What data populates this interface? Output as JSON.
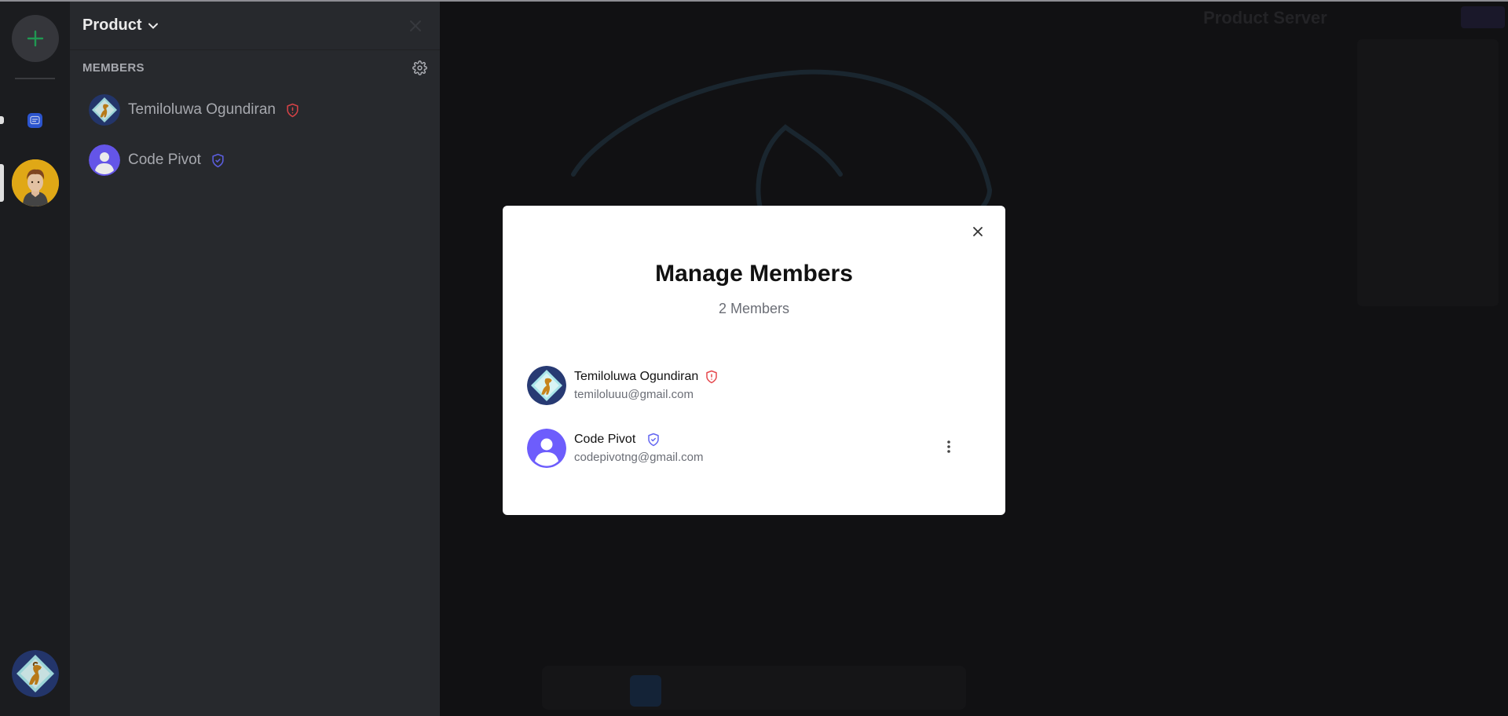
{
  "rail": {
    "add_icon": "plus-icon",
    "accent": "#23a55a",
    "server_icon": "message-square-icon",
    "avatar_icon": "user-avatar-icon"
  },
  "sidebar": {
    "server_name": "Product",
    "members_label": "MEMBERS",
    "members": [
      {
        "name": "Temiloluwa Ogundiran",
        "role_icon": "shield-alert-icon",
        "role_color": "#e5484d"
      },
      {
        "name": "Code Pivot",
        "role_icon": "shield-check-icon",
        "role_color": "#6366f1"
      }
    ]
  },
  "background": {
    "title": "Product Server"
  },
  "modal": {
    "title": "Manage Members",
    "subtitle": "2 Members",
    "members": [
      {
        "name": "Temiloluwa Ogundiran",
        "email": "temiloluuu@gmail.com",
        "role_icon": "shield-alert-icon",
        "role_color": "#e5484d"
      },
      {
        "name": "Code Pivot",
        "email": "codepivotng@gmail.com",
        "role_icon": "shield-check-icon",
        "role_color": "#6366f1",
        "actions_icon": "more-vertical-icon"
      }
    ]
  }
}
